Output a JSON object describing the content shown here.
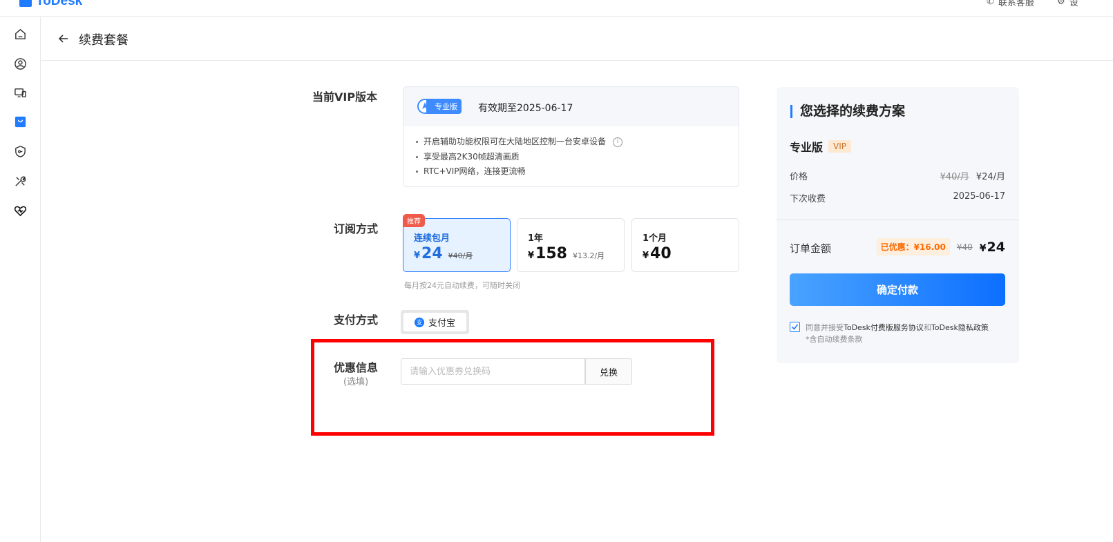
{
  "app": {
    "logo_text": "ToDesk"
  },
  "topbar": {
    "item1_label": "联系客服",
    "item2_label": "设"
  },
  "header": {
    "title": "续费套餐"
  },
  "sidebar": {
    "items": [
      {
        "icon": "home-icon"
      },
      {
        "icon": "user-icon"
      },
      {
        "icon": "devices-icon"
      },
      {
        "icon": "shop-bag-icon",
        "active": true
      },
      {
        "icon": "security-shield-icon"
      },
      {
        "icon": "tools-icon"
      },
      {
        "icon": "heart-icon"
      }
    ]
  },
  "current_vip": {
    "label": "当前VIP版本",
    "badge": "专业版",
    "valid_until": "有效期至2025-06-17",
    "features": [
      "开启辅助功能权限可在大陆地区控制一台安卓设备",
      "享受最高2K30帧超清画质",
      "RTC+VIP网络，连接更流畅"
    ],
    "info_icon": "i"
  },
  "subscription": {
    "label": "订阅方式",
    "recommend_badge": "推荐",
    "plans": [
      {
        "name": "连续包月",
        "currency": "¥",
        "price": "24",
        "note": "¥40/月",
        "selected": true
      },
      {
        "name": "1年",
        "currency": "¥",
        "price": "158",
        "note": "¥13.2/月"
      },
      {
        "name": "1个月",
        "currency": "¥",
        "price": "40",
        "note": ""
      }
    ],
    "hint": "每月按24元自动续费，可随时关闭"
  },
  "payment": {
    "label": "支付方式",
    "method": "支付宝",
    "icon_glyph": "支"
  },
  "coupon": {
    "label": "优惠信息",
    "sublabel": "(选填)",
    "placeholder": "请输入优惠券兑换码",
    "value": "",
    "redeem_label": "兑换"
  },
  "summary": {
    "title": "您选择的续费方案",
    "plan_name": "专业版",
    "plan_tag": "VIP",
    "price_label": "价格",
    "price_old": "¥40/月",
    "price_new": "¥24/月",
    "next_label": "下次收费",
    "next_date": "2025-06-17",
    "order_label": "订单金额",
    "saved": "已优惠：¥16.00",
    "order_old": "¥40",
    "order_currency": "¥",
    "order_final": "24",
    "confirm_label": "确定付款",
    "agree_prefix": "同意并接受",
    "agree_link1": "ToDesk付费版服务协议",
    "agree_and": "和",
    "agree_link2": "ToDesk隐私政策",
    "agree_note": "*含自动续费条款",
    "agree_checked": true
  },
  "colors": {
    "accent": "#1f7bff",
    "highlight": "#ff0000",
    "saved": "#ff6a00"
  }
}
